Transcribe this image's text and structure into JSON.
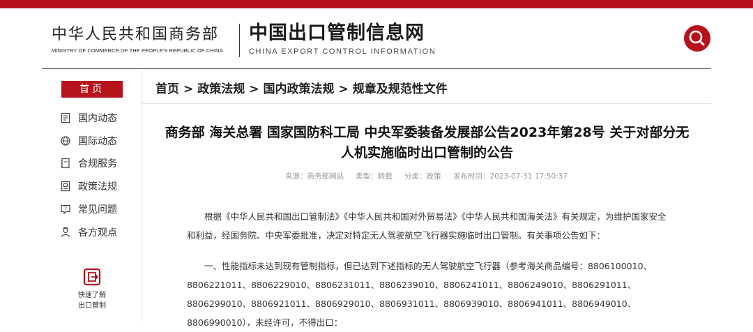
{
  "header": {
    "ministry_cn": "中华人民共和国商务部",
    "ministry_en": "MINISTRY OF COMMERCE OF THE PEOPLE'S REPUBLIC OF CHINA",
    "site_cn": "中国出口管制信息网",
    "site_en": "CHINA EXPORT CONTROL INFORMATION",
    "search_icon": "search-icon",
    "accent_color": "#b5121b"
  },
  "sidebar": {
    "home_label": "首页",
    "items": [
      {
        "label": "国内动态",
        "icon": "document-icon"
      },
      {
        "label": "国际动态",
        "icon": "globe-icon"
      },
      {
        "label": "合规服务",
        "icon": "notebook-icon"
      },
      {
        "label": "政策法规",
        "icon": "book-icon"
      },
      {
        "label": "常见问题",
        "icon": "question-icon"
      },
      {
        "label": "各方观点",
        "icon": "people-icon"
      }
    ],
    "quick_link": {
      "line1": "快速了解",
      "line2": "出口管制",
      "icon": "export-control-icon"
    }
  },
  "breadcrumb": {
    "items": [
      "首页",
      "政策法规",
      "国内政策法规",
      "规章及规范性文件"
    ],
    "separator": ">"
  },
  "article": {
    "title": "商务部 海关总署 国家国防科工局 中央军委装备发展部公告2023年第28号 关于对部分无人机实施临时出口管制的公告",
    "meta": {
      "source": "来源：商务部网站",
      "type": "类型：转载",
      "category": "分类：政策",
      "published": "发布时间：2023-07-31 17:50:37"
    },
    "paragraphs": [
      "根据《中华人民共和国出口管制法》《中华人民共和国对外贸易法》《中华人民共和国海关法》有关规定，为维护国家安全和利益，经国务院、中央军委批准，决定对特定无人驾驶航空飞行器实施临时出口管制。有关事项公告如下：",
      "一、性能指标未达到现有管制指标，但已达到下述指标的无人驾驶航空飞行器（参考海关商品编号：8806100010、8806221011、8806229010、8806231011、8806239010、8806241011、8806249010、8806291011、8806299010、8806921011、8806929010、8806931011、8806939010、8806941011、8806949010、8806990010），未经许可，不得出口："
    ]
  }
}
